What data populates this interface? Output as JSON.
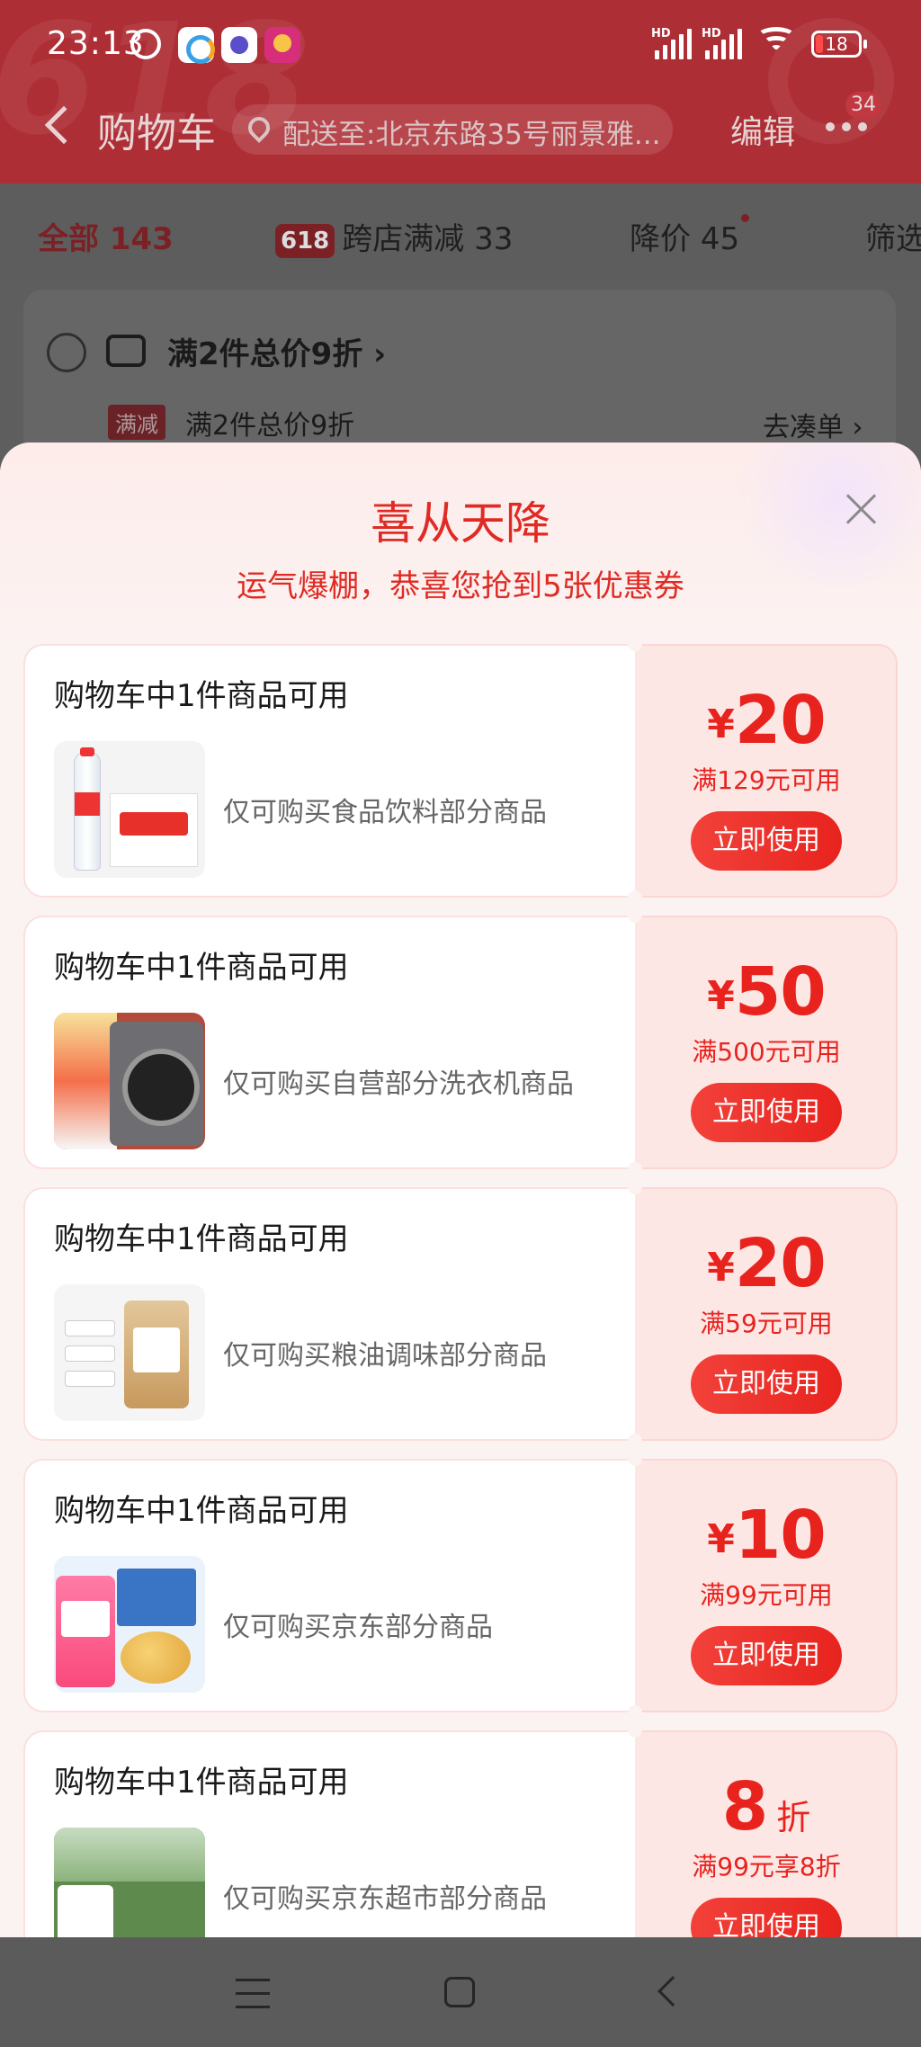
{
  "status_bar": {
    "time": "23:13",
    "battery": "18",
    "network_label": "HD",
    "icons": [
      "alarm-icon",
      "app-icon",
      "app-icon",
      "app-icon",
      "signal-icon",
      "signal-icon",
      "wifi-icon",
      "battery-icon"
    ]
  },
  "header": {
    "title": "购物车",
    "address": "配送至:北京东路35号丽景雅...",
    "edit_label": "编辑",
    "more_badge": "34"
  },
  "tabs": {
    "all_label": "全部",
    "all_count": "143",
    "cross_badge": "618",
    "cross_label": "跨店满减",
    "cross_count": "33",
    "price_drop_label": "降价",
    "price_drop_count": "45",
    "filter_label": "筛选"
  },
  "bg_card": {
    "title": "满2件总价9折 ›",
    "tag": "满减",
    "subtitle": "满2件总价9折",
    "link": "去凑单 ›"
  },
  "popup": {
    "title": "喜从天降",
    "subtitle": "运气爆棚，恭喜您抢到5张优惠券",
    "coupons": [
      {
        "heading": "购物车中1件商品可用",
        "desc": "仅可购买食品饮料部分商品",
        "currency": "¥",
        "amount": "20",
        "unit": "",
        "condition": "满129元可用",
        "button": "立即使用"
      },
      {
        "heading": "购物车中1件商品可用",
        "desc": "仅可购买自营部分洗衣机商品",
        "currency": "¥",
        "amount": "50",
        "unit": "",
        "condition": "满500元可用",
        "button": "立即使用"
      },
      {
        "heading": "购物车中1件商品可用",
        "desc": "仅可购买粮油调味部分商品",
        "currency": "¥",
        "amount": "20",
        "unit": "",
        "condition": "满59元可用",
        "button": "立即使用"
      },
      {
        "heading": "购物车中1件商品可用",
        "desc": "仅可购买京东部分商品",
        "currency": "¥",
        "amount": "10",
        "unit": "",
        "condition": "满99元可用",
        "button": "立即使用"
      },
      {
        "heading": "购物车中1件商品可用",
        "desc": "仅可购买京东超市部分商品",
        "currency": "",
        "amount": "8",
        "unit": "折",
        "condition": "满99元享8折",
        "button": "立即使用"
      }
    ]
  },
  "colors": {
    "accent": "#e8231e",
    "header_bg": "#ae2e35",
    "coupon_right_bg": "#fde7e5",
    "sheet_bg": "#fbf3f2"
  }
}
